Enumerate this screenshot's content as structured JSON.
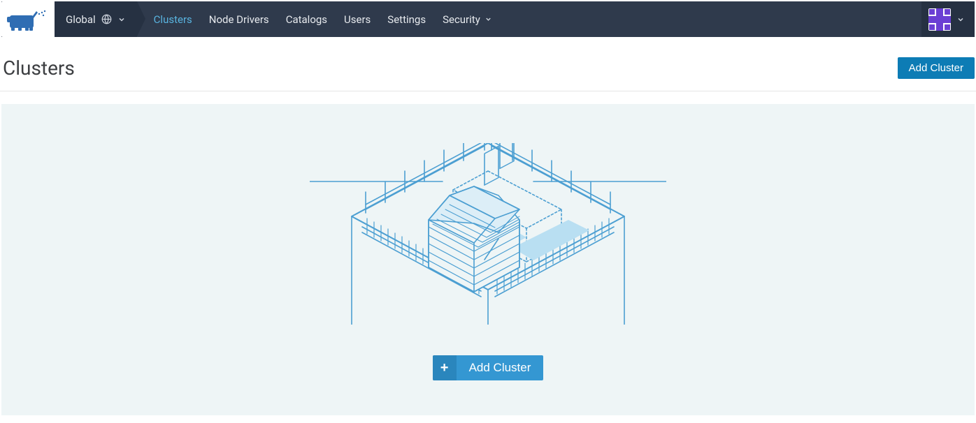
{
  "header": {
    "scope_label": "Global",
    "nav": [
      {
        "label": "Clusters",
        "active": true
      },
      {
        "label": "Node Drivers",
        "active": false
      },
      {
        "label": "Catalogs",
        "active": false
      },
      {
        "label": "Users",
        "active": false
      },
      {
        "label": "Settings",
        "active": false
      },
      {
        "label": "Security",
        "active": false,
        "has_dropdown": true
      }
    ]
  },
  "page": {
    "title": "Clusters",
    "add_button_label": "Add Cluster"
  },
  "empty_state": {
    "add_button_label": "Add Cluster"
  },
  "icons": {
    "logo": "cow-logo",
    "globe": "globe-icon",
    "chevron_down": "chevron-down-icon",
    "plus": "plus-icon"
  },
  "colors": {
    "topbar_bg": "#2f3a4c",
    "topbar_dark": "#263142",
    "accent_link": "#59b4e0",
    "primary_btn": "#0d7cb5",
    "secondary_btn": "#3497d2",
    "empty_bg": "#eef5f6",
    "avatar_accent": "#6b3fd4"
  }
}
